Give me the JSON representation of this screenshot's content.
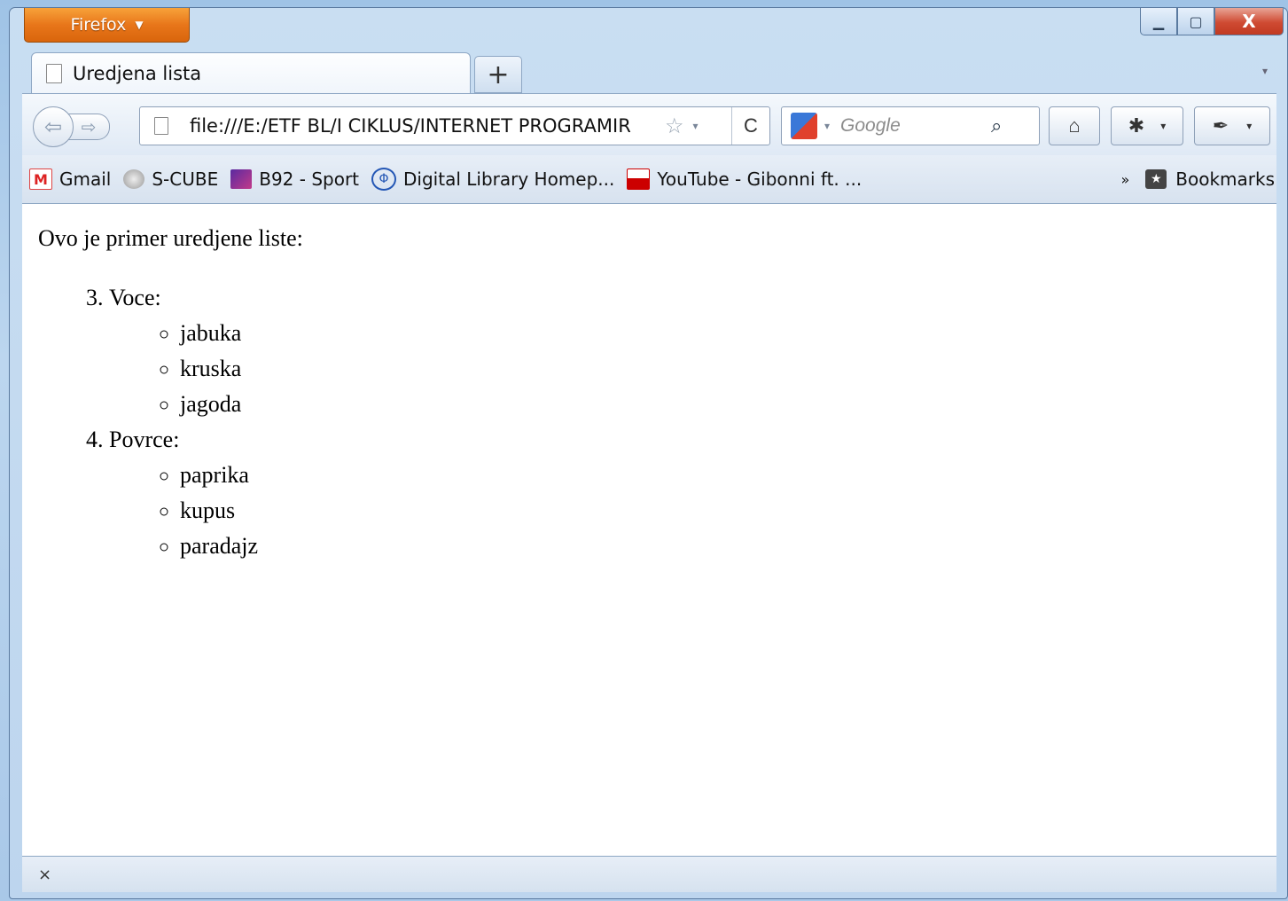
{
  "firefox_button": {
    "label": "Firefox",
    "arrow": "▼"
  },
  "window_controls": {
    "minimize": "▁",
    "maximize": "▢",
    "close": "X"
  },
  "tab": {
    "title": "Uredjena lista"
  },
  "new_tab": {
    "label": "+"
  },
  "list_all_tabs": {
    "label": "▾"
  },
  "navigation": {
    "back": "⇦",
    "forward": "⇨",
    "url": "file:///E:/ETF BL/I CIKLUS/INTERNET PROGRAMIR",
    "bookmark_star": "☆",
    "history_drop": "▾",
    "reload": "C"
  },
  "search": {
    "engine_drop": "▾",
    "placeholder": "Google",
    "submit": "⌕"
  },
  "toolbar": {
    "home": "⌂",
    "addon1": "✱",
    "addon2": "✒",
    "drop": "▾"
  },
  "bookmarks": [
    {
      "label": "Gmail",
      "icon": "gmail-icon"
    },
    {
      "label": "S-CUBE",
      "icon": "s-cube-icon"
    },
    {
      "label": "B92 - Sport",
      "icon": "b92-icon"
    },
    {
      "label": "Digital Library Homep...",
      "icon": "digital-library-icon"
    },
    {
      "label": "YouTube - Gibonni ft. ...",
      "icon": "youtube-icon"
    }
  ],
  "bookmarks_overflow": "»",
  "bookmarks_menu": {
    "label": "Bookmarks"
  },
  "page": {
    "intro": "Ovo je primer uredjene liste:",
    "list_start": 3,
    "items": [
      {
        "label": "Voce:",
        "subitems": [
          "jabuka",
          "kruska",
          "jagoda"
        ]
      },
      {
        "label": "Povrce:",
        "subitems": [
          "paprika",
          "kupus",
          "paradajz"
        ]
      }
    ]
  },
  "statusbar": {
    "close": "×"
  }
}
